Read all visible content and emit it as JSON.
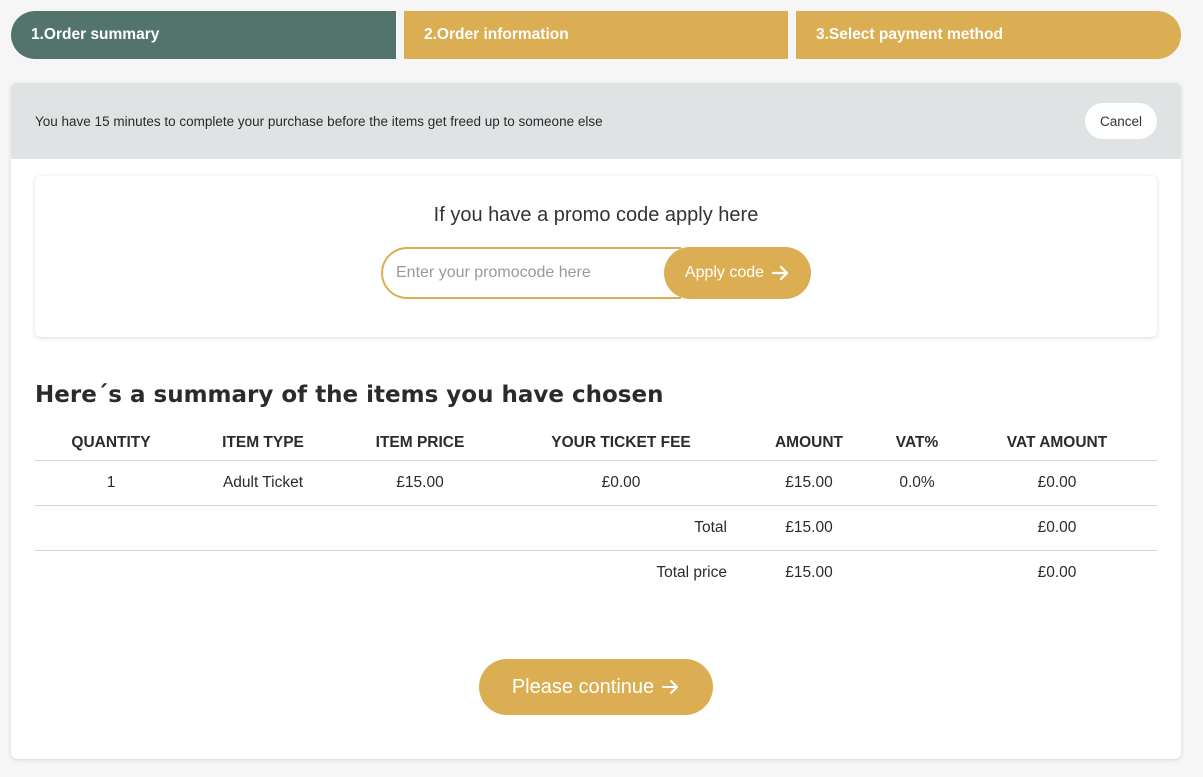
{
  "steps": [
    {
      "label": "1.Order summary"
    },
    {
      "label": "2.Order information"
    },
    {
      "label": "3.Select payment method"
    }
  ],
  "notice": {
    "text": "You have 15 minutes to complete your purchase before the items get freed up to someone else",
    "cancel_label": "Cancel"
  },
  "promo": {
    "title": "If you have a promo code apply here",
    "placeholder": "Enter your promocode here",
    "value": "",
    "apply_label": "Apply code",
    "apply_icon": "arrow-right-icon"
  },
  "summary": {
    "title": "Here´s a summary of the items you have chosen",
    "columns": [
      "QUANTITY",
      "ITEM TYPE",
      "ITEM PRICE",
      "YOUR TICKET FEE",
      "AMOUNT",
      "VAT%",
      "VAT AMOUNT"
    ],
    "rows": [
      {
        "quantity": "1",
        "item_type": "Adult Ticket",
        "item_price": "£15.00",
        "ticket_fee": "£0.00",
        "amount": "£15.00",
        "vat_pct": "0.0%",
        "vat_amount": "£0.00"
      }
    ],
    "total": {
      "label": "Total",
      "amount": "£15.00",
      "vat_amount": "£0.00"
    },
    "total_price": {
      "label": "Total price",
      "amount": "£15.00",
      "vat_amount": "£0.00"
    }
  },
  "continue_label": "Please continue",
  "colors": {
    "accent": "#dcae53",
    "active_step": "#52746d",
    "notice_bg": "#dfe3e3"
  }
}
